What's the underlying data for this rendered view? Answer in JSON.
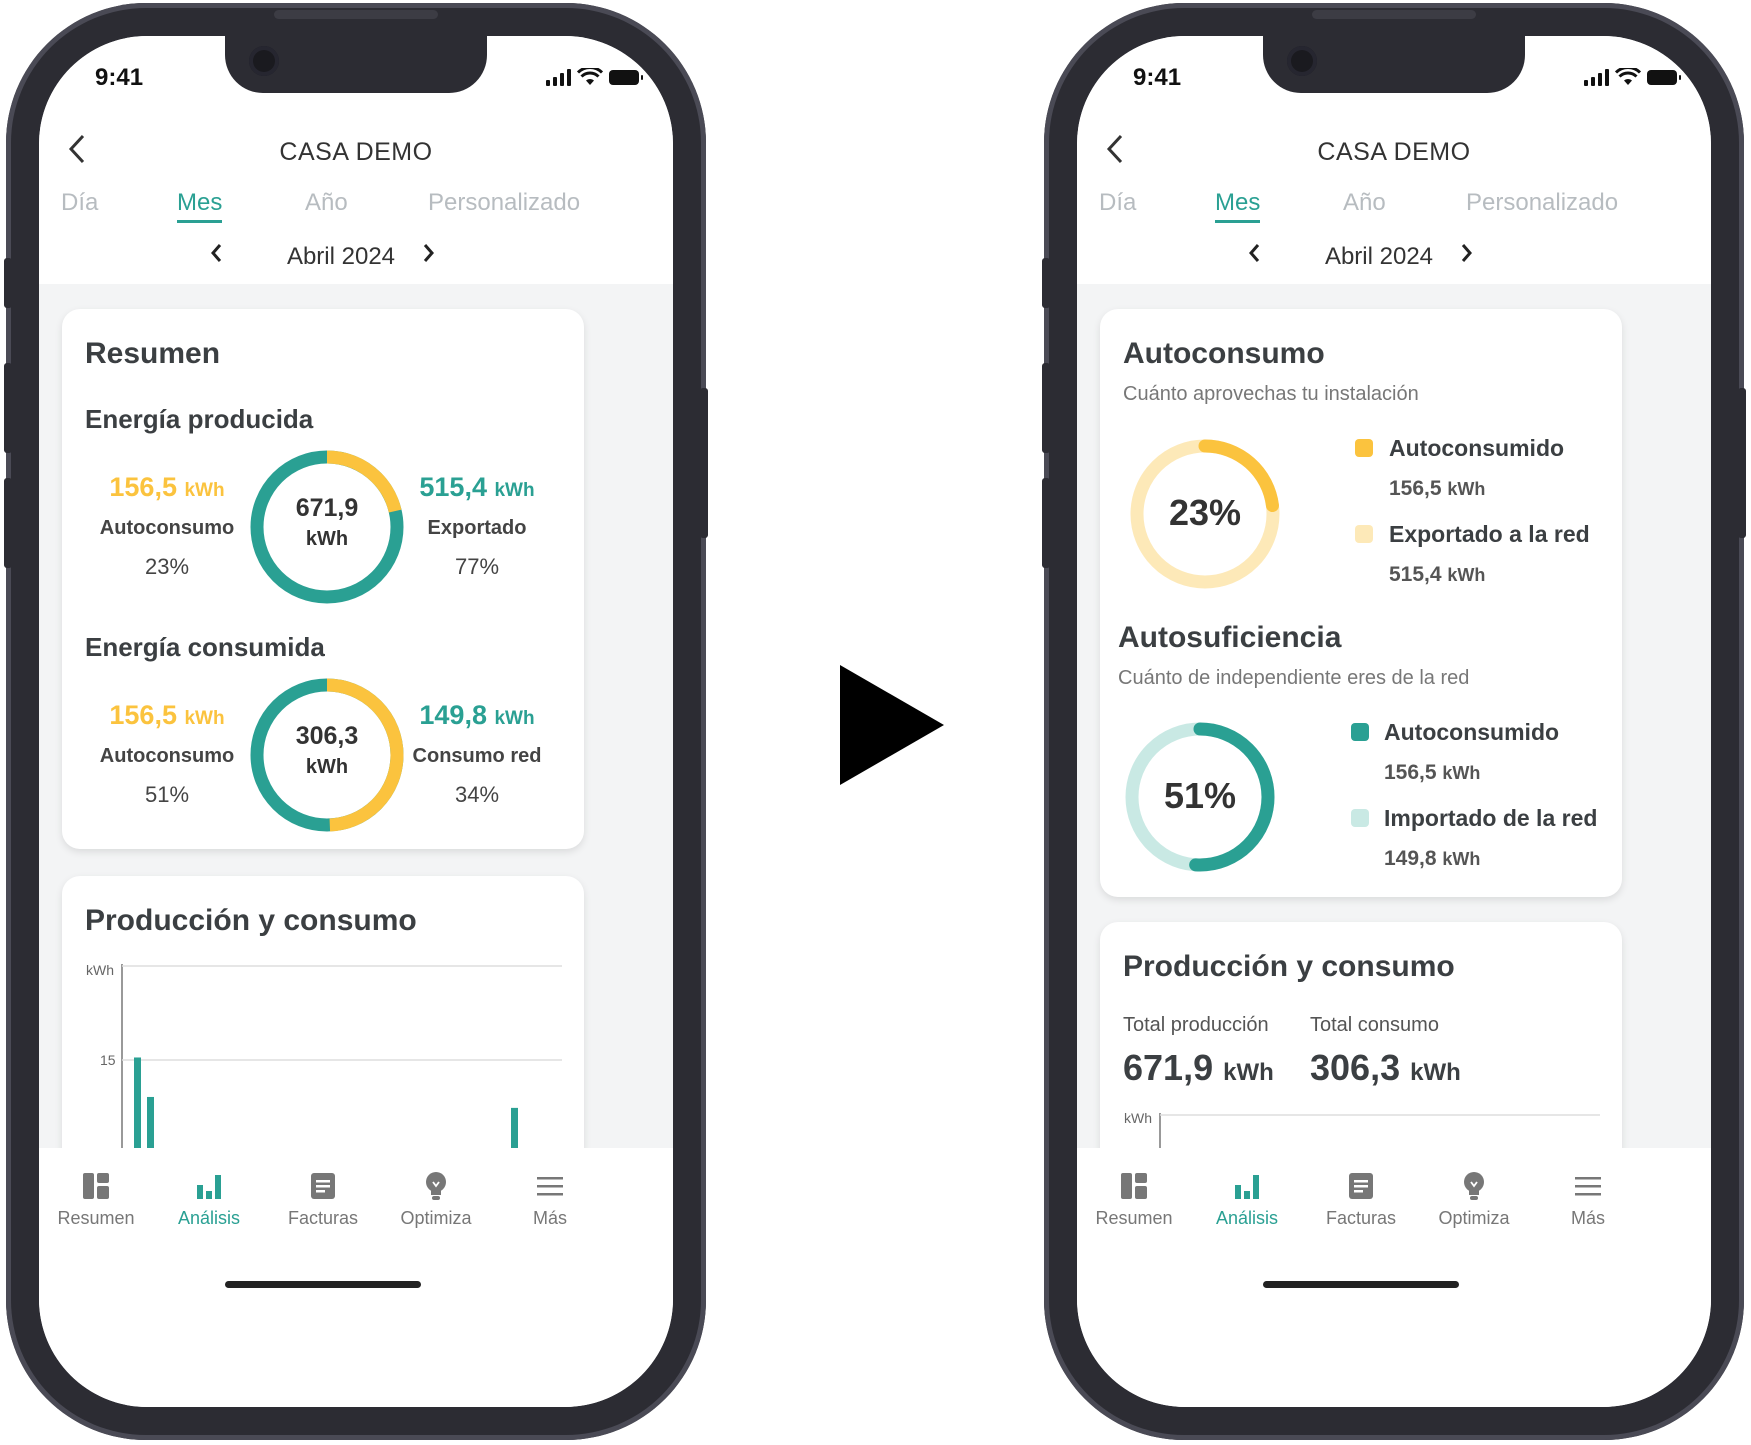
{
  "colors": {
    "teal": "#2aa093",
    "yellow": "#fbc33e",
    "light_yellow": "#fde9b8",
    "light_teal": "#c9e9e4"
  },
  "status": {
    "time": "9:41"
  },
  "header": {
    "title": "CASA DEMO",
    "back_icon": "chevron-left-icon"
  },
  "tabs": [
    "Día",
    "Mes",
    "Año",
    "Personalizado"
  ],
  "active_tab": "Mes",
  "period": {
    "label": "Abril 2024"
  },
  "left": {
    "resumen": {
      "title": "Resumen",
      "produced": {
        "title": "Energía producida",
        "total_value": "671,9",
        "total_unit": "kWh",
        "left_value": "156,5",
        "left_unit": "kWh",
        "left_label": "Autoconsumo",
        "left_pct": "23%",
        "right_value": "515,4",
        "right_unit": "kWh",
        "right_label": "Exportado",
        "right_pct": "77%",
        "fraction_yellow": 0.23
      },
      "consumed": {
        "title": "Energía consumida",
        "total_value": "306,3",
        "total_unit": "kWh",
        "left_value": "156,5",
        "left_unit": "kWh",
        "left_label": "Autoconsumo",
        "left_pct": "51%",
        "right_value": "149,8",
        "right_unit": "kWh",
        "right_label": "Consumo red",
        "right_pct": "34%",
        "fraction_yellow": 0.51
      }
    },
    "production": {
      "title": "Producción y consumo",
      "chart_data": {
        "type": "bar",
        "ylabel": "kWh",
        "yticks": [
          "15"
        ],
        "series": [
          {
            "values": [
              15.3,
              10.6,
              0,
              0,
              0,
              0,
              0,
              0,
              0,
              0,
              0,
              0,
              0,
              0,
              0,
              0,
              0,
              0,
              0,
              0,
              0,
              0,
              0,
              0,
              0,
              0,
              0,
              0,
              0,
              9.3
            ]
          }
        ]
      }
    }
  },
  "right": {
    "autoconsumo": {
      "title": "Autoconsumo",
      "subtitle": "Cuánto aprovechas tu instalación",
      "pct": "23%",
      "fraction": 0.23,
      "items": [
        {
          "label": "Autoconsumido",
          "value": "156,5",
          "unit": "kWh"
        },
        {
          "label": "Exportado a la red",
          "value": "515,4",
          "unit": "kWh"
        }
      ]
    },
    "autosuficiencia": {
      "title": "Autosuficiencia",
      "subtitle": "Cuánto de independiente eres de la red",
      "pct": "51%",
      "fraction": 0.51,
      "items": [
        {
          "label": "Autoconsumido",
          "value": "156,5",
          "unit": "kWh"
        },
        {
          "label": "Importado de la red",
          "value": "149,8",
          "unit": "kWh"
        }
      ]
    },
    "production": {
      "title": "Producción y consumo",
      "total_prod_label": "Total producción",
      "total_prod_value": "671,9",
      "total_prod_unit": "kWh",
      "total_cons_label": "Total consumo",
      "total_cons_value": "306,3",
      "total_cons_unit": "kWh",
      "ylabel": "kWh"
    }
  },
  "nav": [
    {
      "label": "Resumen",
      "icon": "dashboard-icon"
    },
    {
      "label": "Análisis",
      "icon": "bar-chart-icon"
    },
    {
      "label": "Facturas",
      "icon": "invoice-icon"
    },
    {
      "label": "Optimiza",
      "icon": "lightbulb-icon"
    },
    {
      "label": "Más",
      "icon": "menu-icon"
    }
  ]
}
